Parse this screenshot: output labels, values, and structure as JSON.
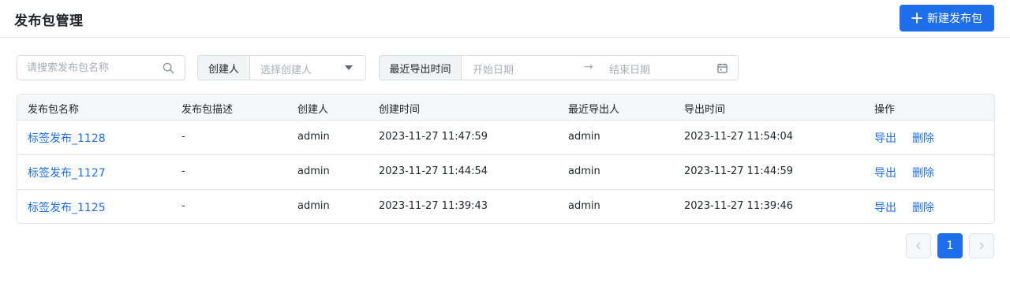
{
  "header": {
    "title": "发布包管理",
    "new_button_label": "新建发布包"
  },
  "filters": {
    "search_placeholder": "请搜索发布包名称",
    "creator_label": "创建人",
    "creator_placeholder": "选择创建人",
    "date_label": "最近导出时间",
    "start_placeholder": "开始日期",
    "arrow": "→",
    "end_placeholder": "结束日期"
  },
  "table": {
    "columns": [
      "发布包名称",
      "发布包描述",
      "创建人",
      "创建时间",
      "最近导出人",
      "导出时间",
      "操作"
    ],
    "rows": [
      {
        "name": "标签发布_1128",
        "desc": "-",
        "creator": "admin",
        "created_at": "2023-11-27 11:47:59",
        "exporter": "admin",
        "exported_at": "2023-11-27 11:54:04"
      },
      {
        "name": "标签发布_1127",
        "desc": "-",
        "creator": "admin",
        "created_at": "2023-11-27 11:44:54",
        "exporter": "admin",
        "exported_at": "2023-11-27 11:44:59"
      },
      {
        "name": "标签发布_1125",
        "desc": "-",
        "creator": "admin",
        "created_at": "2023-11-27 11:39:43",
        "exporter": "admin",
        "exported_at": "2023-11-27 11:39:46"
      }
    ],
    "actions": {
      "export": "导出",
      "delete": "删除"
    }
  },
  "pagination": {
    "current_page": "1"
  },
  "colors": {
    "accent": "#1f6fec",
    "border": "#d9dce1",
    "header_bg": "#f5f6f7"
  }
}
